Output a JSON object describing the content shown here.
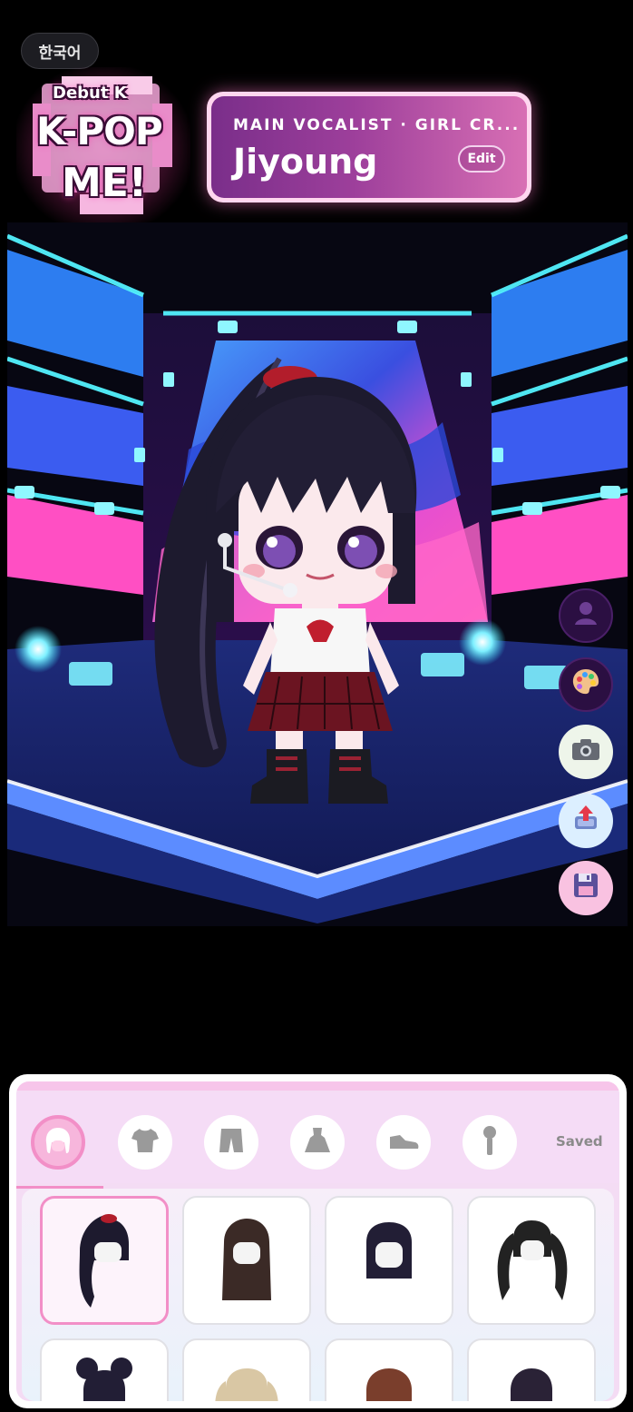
{
  "language_button": {
    "label": "한국어"
  },
  "logo": {
    "top_text": "Debut K",
    "main_text": "K-POP",
    "sub_text": "ME!"
  },
  "profile_card": {
    "role": "MAIN VOCALIST · GIRL CR...",
    "name": "Jiyoung",
    "edit_label": "Edit"
  },
  "side_buttons": [
    {
      "icon": "person-icon"
    },
    {
      "icon": "palette-icon"
    },
    {
      "icon": "camera-icon"
    },
    {
      "icon": "share-icon"
    },
    {
      "icon": "save-icon"
    }
  ],
  "wardrobe": {
    "tabs": [
      {
        "icon": "hair-icon",
        "active": true
      },
      {
        "icon": "shirt-icon",
        "active": false
      },
      {
        "icon": "pants-icon",
        "active": false
      },
      {
        "icon": "dress-icon",
        "active": false
      },
      {
        "icon": "shoe-icon",
        "active": false
      },
      {
        "icon": "microphone-icon",
        "active": false
      }
    ],
    "saved_label": "Saved",
    "items": [
      {
        "name": "long-black-ponytail-hair",
        "selected": true
      },
      {
        "name": "long-brown-straight-hair",
        "selected": false
      },
      {
        "name": "black-bob-hair",
        "selected": false
      },
      {
        "name": "black-twin-tails-hair",
        "selected": false
      },
      {
        "name": "black-space-buns-hair",
        "selected": false
      },
      {
        "name": "blonde-pigtails-hair",
        "selected": false
      },
      {
        "name": "auburn-hair",
        "selected": false
      },
      {
        "name": "dark-short-hair",
        "selected": false
      }
    ]
  },
  "colors": {
    "accent_pink": "#f28fc7",
    "card_gradient_start": "#7a2e8a",
    "card_gradient_end": "#d86fb4",
    "stage_cyan": "#35e0ff",
    "stage_floor": "#1a2a7a"
  }
}
